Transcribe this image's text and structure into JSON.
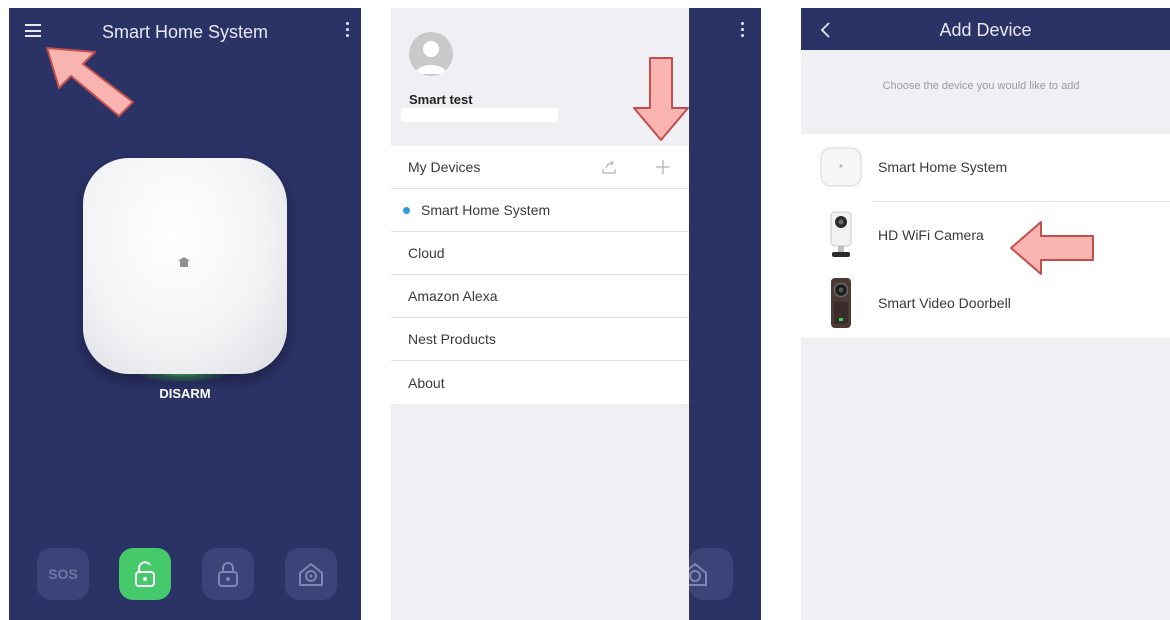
{
  "screen1": {
    "title": "Smart Home System",
    "status": "DISARM",
    "buttons": {
      "sos": "SOS"
    },
    "icons": [
      "menu-icon",
      "more-vert-icon",
      "unlock-icon",
      "lock-icon",
      "home-lock-icon"
    ],
    "colors": {
      "background": "#2b3266",
      "active_button": "#45c96a"
    }
  },
  "screen2": {
    "profile": {
      "name": "Smart test"
    },
    "menu": {
      "my_devices": "My Devices",
      "items": [
        "Smart Home System",
        "Cloud",
        "Amazon Alexa",
        "Nest Products",
        "About"
      ]
    },
    "icons": [
      "avatar-icon",
      "share-icon",
      "plus-icon"
    ],
    "colors": {
      "selected_dot": "#2f9be0"
    }
  },
  "screen3": {
    "title": "Add Device",
    "subtitle": "Choose the device you would like to add",
    "devices": [
      "Smart Home System",
      "HD WiFi Camera",
      "Smart Video Doorbell"
    ],
    "icons": [
      "back-chevron-icon"
    ]
  }
}
